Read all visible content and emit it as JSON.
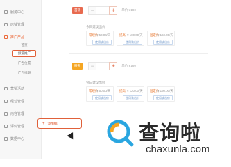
{
  "sidebar": {
    "items": [
      {
        "label": "服务中心"
      },
      {
        "label": "店铺管理"
      },
      {
        "label": "推广产品"
      },
      {
        "label": "广告位"
      },
      {
        "label": "广告排期"
      },
      {
        "label": "营销活动"
      },
      {
        "label": "经营管理"
      },
      {
        "label": "内容管理"
      },
      {
        "label": "评价管理"
      },
      {
        "label": "数据中心"
      }
    ],
    "sub_items": [
      {
        "label": "首页"
      },
      {
        "label": "频道推广"
      },
      {
        "label": "广告位置"
      }
    ]
  },
  "rows": [
    {
      "tag": "首焦",
      "quantity": "",
      "price": "单价 ¥180",
      "subtitle": "今日建议出价",
      "options": [
        {
          "type": "常规价",
          "price": "¥ 50.00/天",
          "action": "使用该出价"
        },
        {
          "type": "提高",
          "price": "¥ 100.00/天",
          "action": "使用该出价"
        },
        {
          "type": "固定价",
          "price": "¥ 160.00/天",
          "action": "使用该出价"
        }
      ]
    },
    {
      "tag": "腰部",
      "quantity": "",
      "price": "单价 ¥180",
      "subtitle": "今日建议出价",
      "options": [
        {
          "type": "常规价",
          "price": "¥ 50.00/天",
          "action": "使用该出价"
        },
        {
          "type": "提高",
          "price": "¥ 120.00/天",
          "action": "使用该出价"
        },
        {
          "type": "固定价",
          "price": "¥ 160.00/天",
          "action": "使用该出价"
        }
      ]
    }
  ],
  "add_button": {
    "plus": "+",
    "label": "添加推广"
  },
  "watermark": {
    "title": "查询啦",
    "subtitle": "chaxunla.com"
  },
  "colors": {
    "accent": "#e0613a",
    "tag_red": "#e86a4f",
    "tag_orange": "#f5a623",
    "link_blue": "#6b94c8"
  }
}
